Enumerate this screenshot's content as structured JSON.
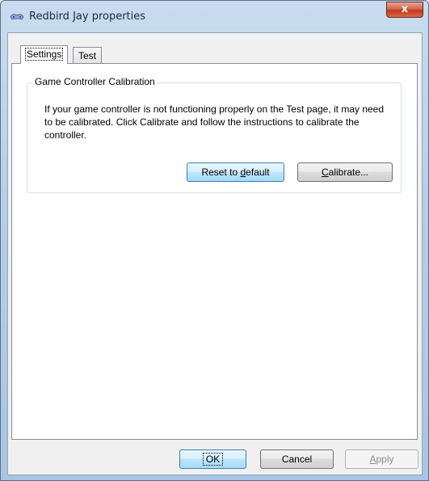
{
  "window": {
    "title": "Redbird Jay properties",
    "close_glyph": "x",
    "icon": "game-controller-icon"
  },
  "tabs": [
    {
      "label": "Settings",
      "active": true
    },
    {
      "label": "Test",
      "active": false
    }
  ],
  "settings": {
    "group_title": "Game Controller Calibration",
    "description": "If your game controller is not functioning properly on the Test page, it may need to be calibrated.  Click Calibrate and follow the instructions to calibrate the controller.",
    "reset_button": {
      "pre": "Reset to ",
      "accel": "d",
      "post": "efault"
    },
    "calibrate_button": {
      "pre": "",
      "accel": "C",
      "post": "alibrate..."
    }
  },
  "footer": {
    "ok_label": "OK",
    "cancel_label": "Cancel",
    "apply_button": {
      "pre": "",
      "accel": "A",
      "post": "pply"
    }
  }
}
